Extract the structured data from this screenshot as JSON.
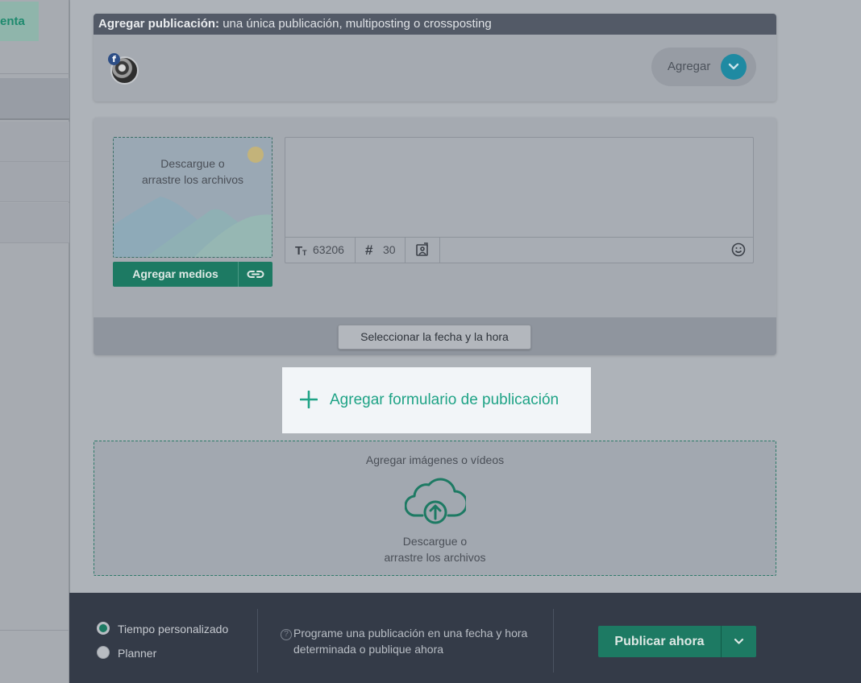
{
  "sidebar": {
    "account_label": "enta"
  },
  "publication_header": {
    "title_bold": "Agregar publicación:",
    "title_rest": " una única publicación, multiposting o crossposting",
    "social_badge": "f",
    "add_label": "Agregar"
  },
  "post_form": {
    "dropzone_text_1": "Descargue o",
    "dropzone_text_2": "arrastre los archivos",
    "add_media_label": "Agregar medios",
    "char_count": "63206",
    "hashtag_count": "30",
    "text_value": "",
    "date_button_label": "Seleccionar la fecha y la hora"
  },
  "add_form": {
    "label": "Agregar formulario de publicación"
  },
  "media_dropzone": {
    "title": "Agregar imágenes o vídeos",
    "text_1": "Descargue o",
    "text_2": "arrastre los archivos"
  },
  "footer": {
    "option_custom": "Tiempo personalizado",
    "option_planner": "Planner",
    "help_text_1": "Programe una publicación en una fecha y hora",
    "help_text_2": "determinada o publique ahora",
    "help_icon": "?",
    "publish_label": "Publicar ahora"
  },
  "colors": {
    "accent": "#1d7a63",
    "highlight_text": "#1fa386",
    "footer_bg": "#343b48"
  }
}
